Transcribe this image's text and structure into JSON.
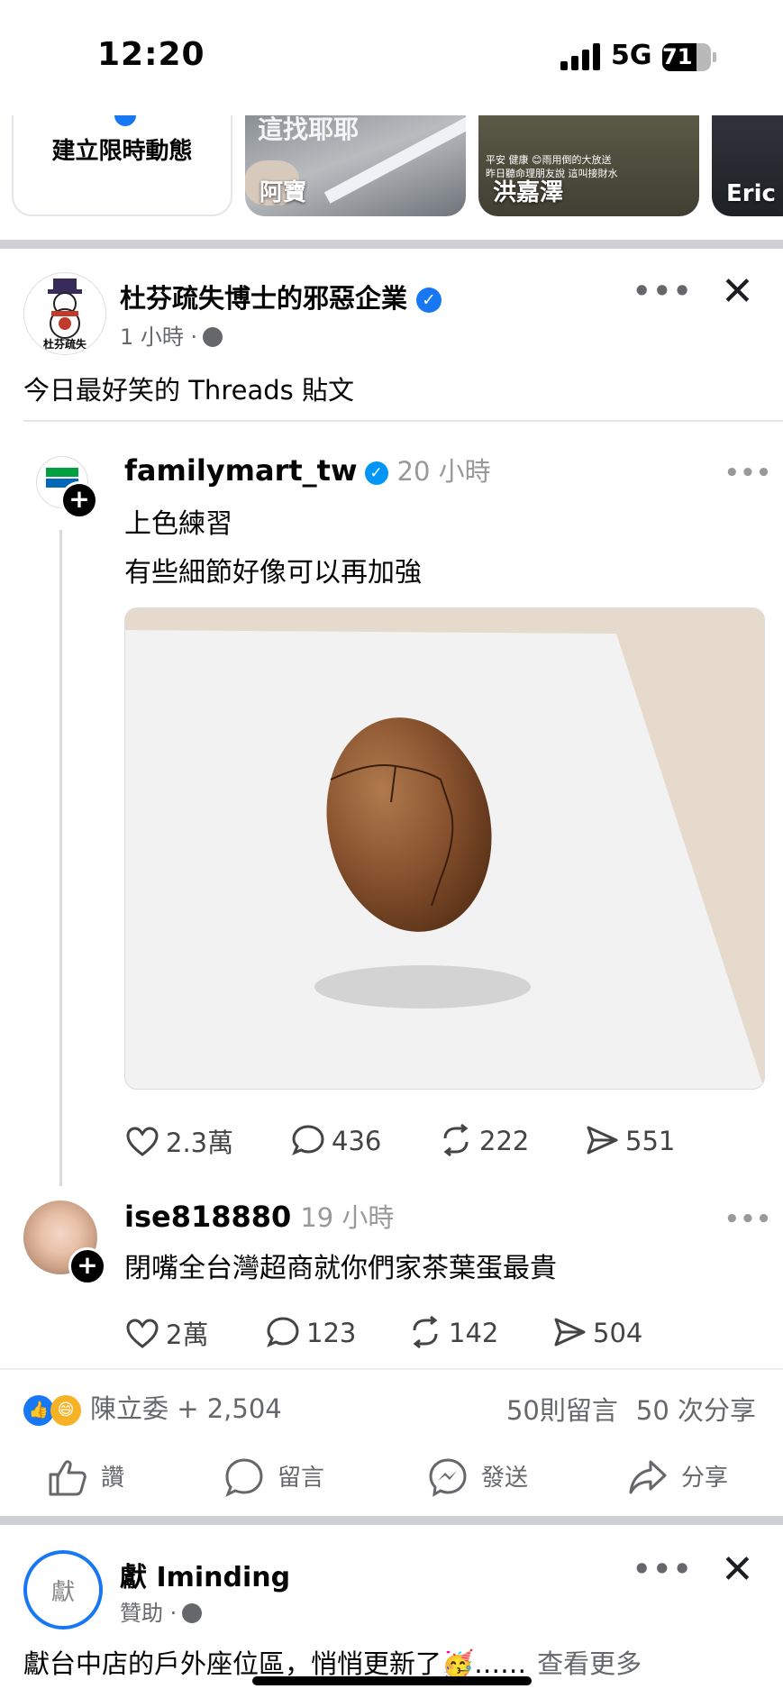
{
  "status_bar": {
    "time": "12:20",
    "network": "5G",
    "battery": "71"
  },
  "stories": {
    "create_label": "建立限時動態",
    "items": [
      {
        "name": "阿寶",
        "top_text": "這找耶耶"
      },
      {
        "name": "洪嘉澤",
        "caption": "平安 健康 😊雨用倒的大放送\n昨日聽命理朋友說 這叫接財水"
      },
      {
        "name": "Eric L"
      }
    ]
  },
  "post": {
    "avatar_text": "杜芬疏失",
    "author": "杜芬疏失博士的邪惡企業",
    "time": "1 小時 ·",
    "text": "今日最好笑的 Threads 貼文",
    "thread": {
      "author": "familymart_tw",
      "time": "20 小時",
      "line1": "上色練習",
      "line2": "有些細節好像可以再加強",
      "stats": {
        "likes": "2.3萬",
        "comments": "436",
        "reposts": "222",
        "shares": "551"
      },
      "reply": {
        "author": "ise818880",
        "time": "19 小時",
        "text": "閉嘴全台灣超商就你們家茶葉蛋最貴",
        "stats": {
          "likes": "2萬",
          "comments": "123",
          "reposts": "142",
          "shares": "504"
        }
      }
    },
    "reactions_text": "陳立委 + 2,504",
    "comments_count": "50則留言",
    "shares_count": "50 次分享",
    "actions": {
      "like": "讚",
      "comment": "留言",
      "send": "發送",
      "share": "分享"
    }
  },
  "post2": {
    "avatar_text": "獻",
    "author": "獻 Iminding",
    "meta": "贊助 ·",
    "text": "獻台中店的戶外座位區，悄悄更新了🥳……",
    "see_more": "查看更多"
  }
}
